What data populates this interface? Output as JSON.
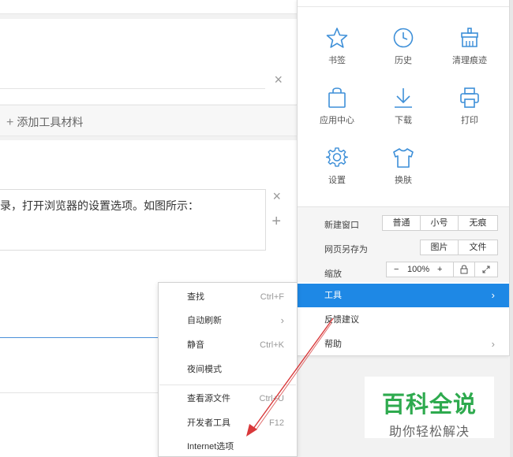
{
  "editor": {
    "close_glyph": "×",
    "add_material_plus": "+",
    "add_material_label": "添加工具材料",
    "step_text": "录，打开浏览器的设置选项。如图所示：",
    "plus_glyph": "+"
  },
  "main_menu": {
    "icons": [
      {
        "label": "书签",
        "icon": "star-icon"
      },
      {
        "label": "历史",
        "icon": "clock-icon"
      },
      {
        "label": "清理痕迹",
        "icon": "eraser-icon"
      },
      {
        "label": "应用中心",
        "icon": "bag-icon"
      },
      {
        "label": "下载",
        "icon": "download-icon"
      },
      {
        "label": "打印",
        "icon": "printer-icon"
      },
      {
        "label": "设置",
        "icon": "gear-icon"
      },
      {
        "label": "换肤",
        "icon": "shirt-icon"
      }
    ],
    "new_window": {
      "label": "新建窗口",
      "options": [
        "普通",
        "小号",
        "无痕"
      ]
    },
    "save_as": {
      "label": "网页另存为",
      "options": [
        "图片",
        "文件"
      ]
    },
    "zoom": {
      "label": "缩放",
      "minus": "−",
      "value": "100%",
      "plus": "+"
    },
    "rows": [
      {
        "label": "工具",
        "arrow": "›"
      },
      {
        "label": "反馈建议",
        "arrow": ""
      },
      {
        "label": "帮助",
        "arrow": "›"
      }
    ]
  },
  "tools_submenu": {
    "items": [
      {
        "label": "查找",
        "shortcut": "Ctrl+F"
      },
      {
        "label": "自动刷新",
        "shortcut": "›"
      },
      {
        "label": "静音",
        "shortcut": "Ctrl+K"
      },
      {
        "label": "夜间模式",
        "shortcut": ""
      },
      {
        "label": "查看源文件",
        "shortcut": "Ctrl+U"
      },
      {
        "label": "开发者工具",
        "shortcut": "F12"
      },
      {
        "label": "Internet选项",
        "shortcut": ""
      }
    ]
  },
  "watermark": {
    "title": "百科全说",
    "subtitle": "助你轻松解决"
  },
  "colors": {
    "accent": "#1e88e5",
    "icon_blue": "#3d8fd8",
    "watermark_green": "#2eaa4e",
    "annotation_red": "#d9383a"
  }
}
